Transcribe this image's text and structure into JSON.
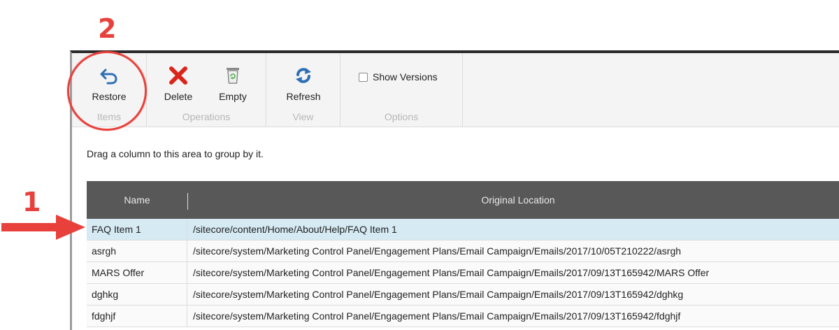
{
  "annotations": {
    "step1": "1",
    "step2": "2"
  },
  "ribbon": {
    "groups": {
      "items": "Items",
      "operations": "Operations",
      "view": "View",
      "options": "Options"
    },
    "buttons": {
      "restore": "Restore",
      "delete": "Delete",
      "empty": "Empty",
      "refresh": "Refresh"
    },
    "show_versions": {
      "label": "Show Versions",
      "checked": false
    }
  },
  "drag_hint": "Drag a column to this area to group by it.",
  "grid": {
    "columns": [
      "Name",
      "Original Location"
    ],
    "rows": [
      {
        "name": "FAQ Item 1",
        "location": "/sitecore/content/Home/About/Help/FAQ Item 1",
        "selected": true
      },
      {
        "name": "asrgh",
        "location": "/sitecore/system/Marketing Control Panel/Engagement Plans/Email Campaign/Emails/2017/10/05T210222/asrgh"
      },
      {
        "name": "MARS Offer",
        "location": "/sitecore/system/Marketing Control Panel/Engagement Plans/Email Campaign/Emails/2017/09/13T165942/MARS Offer"
      },
      {
        "name": "dghkg",
        "location": "/sitecore/system/Marketing Control Panel/Engagement Plans/Email Campaign/Emails/2017/09/13T165942/dghkg"
      },
      {
        "name": "fdghjf",
        "location": "/sitecore/system/Marketing Control Panel/Engagement Plans/Email Campaign/Emails/2017/09/13T165942/fdghjf"
      }
    ]
  },
  "colors": {
    "annotation_red": "#e8413b",
    "header_bg": "#585858",
    "selected_row": "#d5eaf3",
    "restore_icon": "#2f6fb5",
    "delete_icon": "#d9261c"
  }
}
